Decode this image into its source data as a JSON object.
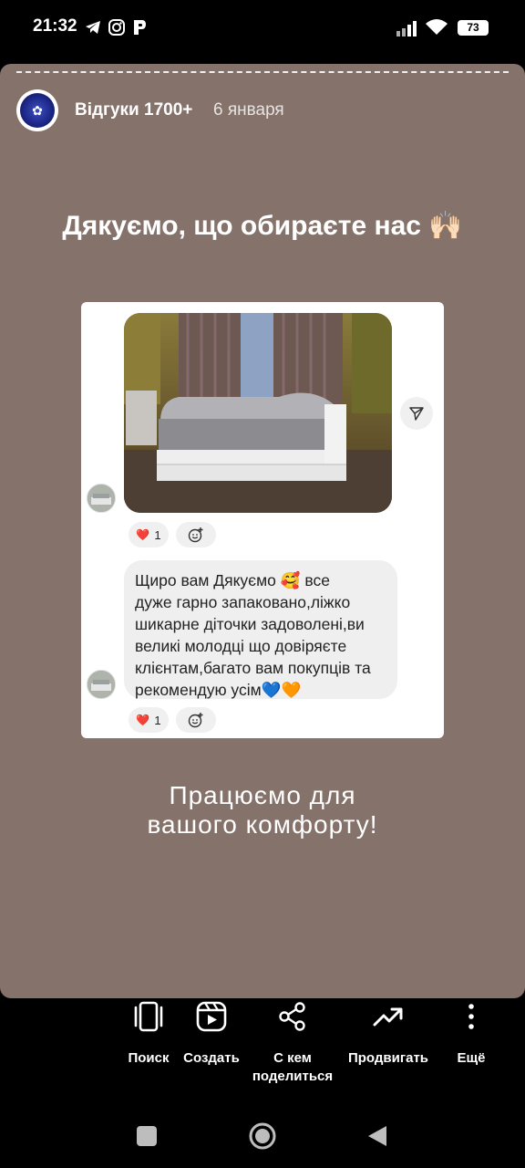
{
  "status_bar": {
    "time": "21:32",
    "battery": "73",
    "icons": [
      "telegram-icon",
      "instagram-icon",
      "app-icon",
      "signal-icon",
      "wifi-icon",
      "battery-icon"
    ]
  },
  "story": {
    "account_name": "Відгуки 1700+",
    "date": "6 января",
    "headline": "Дякуємо, що обираєте нас 🙌🏻",
    "message": {
      "reaction_count_1": "1",
      "reaction_count_2": "1",
      "reaction_emoji": "❤️",
      "lines": [
        "Щиро вам Дякуємо 🥰 все",
        "дуже гарно запаковано,ліжко",
        "шикарне діточки задоволені,ви",
        "великі молодці що довіряєте",
        "клієнтам,багато вам покупців та",
        "рекомендую усім💙🧡"
      ]
    },
    "tagline_line1": "Працюємо для",
    "tagline_line2": "вашого комфорту!",
    "background_color": "#85726a"
  },
  "actions": {
    "search": "Поиск",
    "create": "Создать",
    "share_line1": "С кем",
    "share_line2": "поделиться",
    "promote": "Продвигать",
    "more": "Ещё"
  }
}
